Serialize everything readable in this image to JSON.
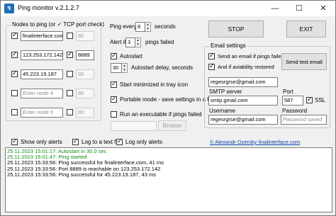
{
  "titlebar": {
    "title": "Ping monitor v.2.1.2.7",
    "app_icon": "ping-monitor-app-icon",
    "minimize": "—",
    "maximize": "☐",
    "close": "✕"
  },
  "nodes_group": {
    "title": "Nodes to ping (or ✓ TCP port check)",
    "rows": [
      {
        "checked": true,
        "host": "finalinterface.com",
        "port_checked": false,
        "port": "80",
        "host_placeholder": false,
        "port_disabled": true
      },
      {
        "checked": true,
        "host": "123.253.172.142",
        "port_checked": true,
        "port": "8889",
        "host_placeholder": false,
        "port_disabled": false
      },
      {
        "checked": true,
        "host": "45.223.19.187",
        "port_checked": false,
        "port": "80",
        "host_placeholder": false,
        "port_disabled": true
      },
      {
        "checked": false,
        "host": "Enter node 4",
        "port_checked": false,
        "port": "80",
        "host_placeholder": true,
        "port_disabled": true
      },
      {
        "checked": false,
        "host": "Enter node 5",
        "port_checked": false,
        "port": "80",
        "host_placeholder": true,
        "port_disabled": true
      }
    ]
  },
  "settings": {
    "ping_every_label": "Ping every",
    "ping_every_value": "8",
    "seconds_label": "seconds",
    "alert_if_label": "Alert if",
    "alert_if_value": "3",
    "pings_failed_label": "pings failed",
    "autostart_label": "Autostart",
    "autostart_checked": true,
    "autostart_delay_value": "30",
    "autostart_delay_label": "Autostart delay, seconds",
    "start_minimized_label": "Start minimized in tray icon",
    "start_minimized_checked": true,
    "portable_label": "Portable mode - save settings in a file",
    "portable_checked": true,
    "run_exec_label": "Run an executable if pings failed",
    "run_exec_checked": false,
    "exec_path": "",
    "browse_label": "Browse"
  },
  "buttons": {
    "stop": "STOP",
    "exit": "EXIT",
    "send_test_email": "Send test email"
  },
  "email": {
    "title": "Email settings",
    "send_if_failed_label": "Send an email if pings failed",
    "send_if_failed_checked": true,
    "send_if_restored_label": "And if aviability restored",
    "send_if_restored_checked": true,
    "to_address": "regesrgrse@gmail.com",
    "smtp_label": "SMTP server",
    "smtp_value": "smtp.gmail.com",
    "port_label": "Port",
    "port_value": "587",
    "ssl_label": "SSL",
    "ssl_checked": true,
    "username_label": "Username",
    "username_value": "regesrgrse@gmail.com",
    "password_label": "Password",
    "password_placeholder": "Password saved"
  },
  "options_row": {
    "show_only_alerts_label": "Show only alerts",
    "show_only_alerts_checked": true,
    "log_to_file_label": "Log to a text file",
    "log_to_file_checked": true,
    "log_only_alerts_label": "Log only alerts",
    "log_only_alerts_checked": true,
    "copyright_link": "© Alexandr Ozersky finalinterface.com"
  },
  "log_lines": [
    {
      "text": "25.11.2023 15:01:17: Autostart in 30.0 sec",
      "color": "#1a8a1a"
    },
    {
      "text": "25.11.2023 15:01:47: Ping started",
      "color": "#1a8a1a"
    },
    {
      "text": "25.11.2023 15:33:56: Ping successful for finalinterface.com, 41 ms",
      "color": "#000000"
    },
    {
      "text": "25.11.2023 15:33:56: Port 8889 is reachable on 123.253.172.142",
      "color": "#000000"
    },
    {
      "text": "25.11.2023 15:33:56: Ping successful for 45.223.19.187, 43 ms",
      "color": "#000000"
    }
  ]
}
